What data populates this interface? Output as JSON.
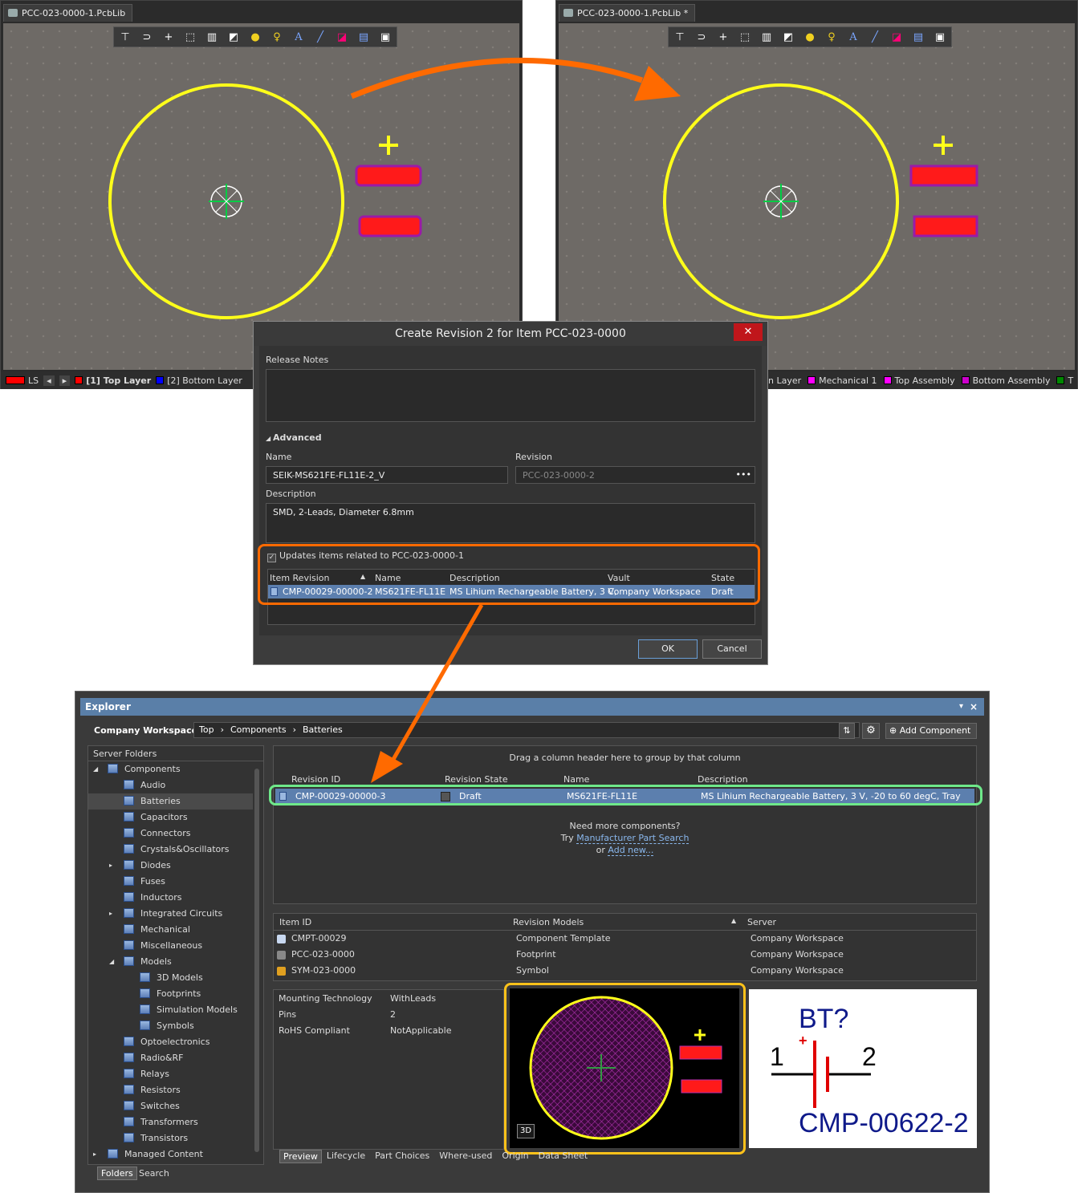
{
  "left_editor": {
    "tab_title": "PCC-023-0000-1.PcbLib",
    "layers": [
      {
        "label": "LS",
        "color": "#ff0000"
      },
      {
        "label": "[1] Top Layer",
        "color": "#ff0000",
        "active": true
      },
      {
        "label": "[2] Bottom Layer",
        "color": "#0000ff"
      }
    ]
  },
  "right_editor": {
    "tab_title": "PCC-023-0000-1.PcbLib *",
    "layers": [
      {
        "label": "n Layer",
        "color": ""
      },
      {
        "label": "Mechanical 1",
        "color": "#ff00ff"
      },
      {
        "label": "Top Assembly",
        "color": "#ff00ff"
      },
      {
        "label": "Bottom Assembly",
        "color": "#cc00cc"
      },
      {
        "label": "T",
        "color": "#008800"
      }
    ]
  },
  "toolbar_icons": [
    "filter-icon",
    "route-icon",
    "plus-icon",
    "select-rect-icon",
    "chart-icon",
    "part-icon",
    "pad-icon",
    "via-icon",
    "text-icon",
    "line-icon",
    "graph-icon",
    "counter-icon",
    "zoom-icon"
  ],
  "footprint": {
    "pad_plus_symbol": "+"
  },
  "dialog": {
    "title": "Create Revision 2 for Item PCC-023-0000",
    "close_label": "✕",
    "release_notes_label": "Release Notes",
    "release_notes_value": "",
    "advanced_label": "Advanced",
    "name_label": "Name",
    "name_value": "SEIK-MS621FE-FL11E-2_V",
    "revision_label": "Revision",
    "revision_value": "PCC-023-0000-2",
    "revision_more": "•••",
    "description_label": "Description",
    "description_value": "SMD, 2-Leads, Diameter 6.8mm",
    "updates_label": "Updates items related to PCC-023-0000-1",
    "updates_checked": true,
    "columns": [
      "Item Revision",
      "Name",
      "Description",
      "Vault",
      "State"
    ],
    "row": {
      "item_revision": "CMP-00029-00000-2",
      "name": "MS621FE-FL11E",
      "description": "MS Lihium Rechargeable Battery, 3 V,",
      "vault": "Company Workspace",
      "state": "Draft"
    },
    "ok_label": "OK",
    "cancel_label": "Cancel"
  },
  "explorer": {
    "title": "Explorer",
    "title_icons": [
      "▾",
      "×"
    ],
    "workspace": "Company Workspace",
    "breadcrumb": [
      "Top",
      "Components",
      "Batteries"
    ],
    "add_component_label": "Add Component",
    "server_folders_label": "Server Folders",
    "tree": [
      {
        "label": "Components",
        "level": 0,
        "expanded": true
      },
      {
        "label": "Audio",
        "level": 1
      },
      {
        "label": "Batteries",
        "level": 1,
        "selected": true
      },
      {
        "label": "Capacitors",
        "level": 1
      },
      {
        "label": "Connectors",
        "level": 1
      },
      {
        "label": "Crystals&Oscillators",
        "level": 1
      },
      {
        "label": "Diodes",
        "level": 1,
        "collapsed": true
      },
      {
        "label": "Fuses",
        "level": 1
      },
      {
        "label": "Inductors",
        "level": 1
      },
      {
        "label": "Integrated Circuits",
        "level": 1,
        "collapsed": true
      },
      {
        "label": "Mechanical",
        "level": 1
      },
      {
        "label": "Miscellaneous",
        "level": 1
      },
      {
        "label": "Models",
        "level": 1,
        "expanded": true
      },
      {
        "label": "3D Models",
        "level": 2
      },
      {
        "label": "Footprints",
        "level": 2
      },
      {
        "label": "Simulation Models",
        "level": 2
      },
      {
        "label": "Symbols",
        "level": 2
      },
      {
        "label": "Optoelectronics",
        "level": 1
      },
      {
        "label": "Radio&RF",
        "level": 1
      },
      {
        "label": "Relays",
        "level": 1
      },
      {
        "label": "Resistors",
        "level": 1
      },
      {
        "label": "Switches",
        "level": 1
      },
      {
        "label": "Transformers",
        "level": 1
      },
      {
        "label": "Transistors",
        "level": 1
      },
      {
        "label": "Managed Content",
        "level": 0,
        "collapsed": true
      }
    ],
    "bottom_tabs": [
      "Folders",
      "Search"
    ],
    "group_hint": "Drag a column header here to group by that column",
    "grid_columns": [
      "Revision ID",
      "Revision State",
      "Name",
      "Description"
    ],
    "grid_row": {
      "revision_id": "CMP-00029-00000-3",
      "state": "Draft",
      "name": "MS621FE-FL11E",
      "description": "MS Lihium Rechargeable Battery, 3 V, -20 to 60 degC, Tray"
    },
    "more_text": "Need more components?",
    "try_text": "Try",
    "mps_link": "Manufacturer Part Search",
    "or_text": "or",
    "add_new_link": "Add new...",
    "models_columns": [
      "Item ID",
      "Revision Models",
      "Server"
    ],
    "models": [
      {
        "item_id": "CMPT-00029",
        "model": "Component Template",
        "server": "Company Workspace"
      },
      {
        "item_id": "PCC-023-0000",
        "model": "Footprint",
        "server": "Company Workspace"
      },
      {
        "item_id": "SYM-023-0000",
        "model": "Symbol",
        "server": "Company Workspace"
      }
    ],
    "params": [
      {
        "name": "Mounting Technology",
        "value": "WithLeads"
      },
      {
        "name": "Pins",
        "value": "2"
      },
      {
        "name": "RoHS Compliant",
        "value": "NotApplicable"
      }
    ],
    "preview_3d": "3D",
    "symbol": {
      "designator": "BT?",
      "pin1": "1",
      "pin2": "2",
      "plus": "+",
      "comment": "CMP-00622-2"
    },
    "detail_tabs": [
      "Preview",
      "Lifecycle",
      "Part Choices",
      "Where-used",
      "Origin",
      "Data Sheet"
    ]
  }
}
